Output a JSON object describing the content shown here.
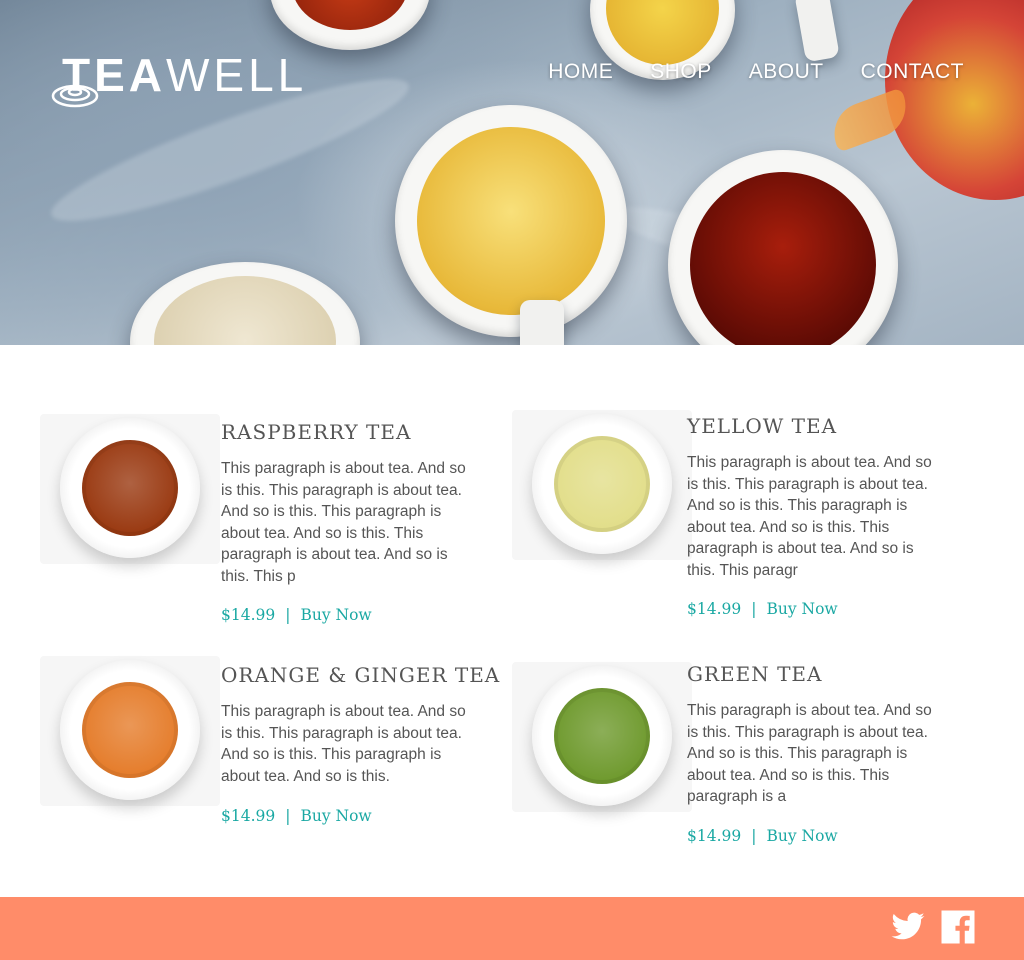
{
  "brand": {
    "logo_bold": "TEA",
    "logo_light": "WELL"
  },
  "nav": {
    "items": [
      {
        "label": "HOME"
      },
      {
        "label": "SHOP"
      },
      {
        "label": "ABOUT"
      },
      {
        "label": "CONTACT"
      }
    ]
  },
  "products": [
    {
      "name": "RASPBERRY TEA",
      "description": "This paragraph is about tea. And so is this. This paragraph is about tea. And so is this. This paragraph is about tea. And so is this. This paragraph is about tea. And so is this. This p",
      "price": "$14.99",
      "separator": "|",
      "buy_label": "Buy Now",
      "tea_color": "#9a3a12"
    },
    {
      "name": "YELLOW TEA",
      "description": "This paragraph is about tea. And so is this. This paragraph is about tea. And so is this. This paragraph is about tea. And so is this. This paragraph is about tea. And so is this. This paragr",
      "price": "$14.99",
      "separator": "|",
      "buy_label": "Buy Now",
      "tea_color": "#e2de8a"
    },
    {
      "name": "ORANGE & GINGER TEA",
      "description": "This paragraph is about tea. And so is this. This paragraph is about tea. And so is this. This paragraph is about tea. And so is this.",
      "price": "$14.99",
      "separator": "|",
      "buy_label": "Buy Now",
      "tea_color": "#e57d2c"
    },
    {
      "name": "GREEN TEA",
      "description": "This paragraph is about tea. And so is this. This paragraph is about tea. And so is this. This paragraph is about tea. And so is this. This paragraph is a",
      "price": "$14.99",
      "separator": "|",
      "buy_label": "Buy Now",
      "tea_color": "#6f9a2e"
    }
  ],
  "footer": {
    "social": [
      {
        "icon": "twitter-icon"
      },
      {
        "icon": "facebook-icon"
      }
    ]
  },
  "colors": {
    "accent": "#1aa8a3",
    "footer_bg": "#ff8c69",
    "text": "#555555"
  }
}
